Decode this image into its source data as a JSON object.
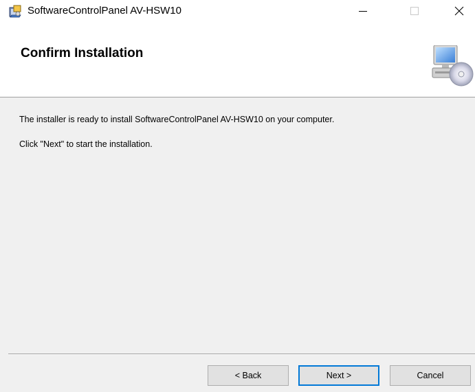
{
  "window": {
    "title": "SoftwareControlPanel AV-HSW10",
    "icons": {
      "app": "installer-app-icon",
      "minimize": "minimize-icon",
      "maximize": "maximize-icon",
      "close": "close-icon"
    }
  },
  "banner": {
    "title": "Confirm Installation",
    "icon": "computer-cd-icon"
  },
  "content": {
    "message_ready": "The installer is ready to install SoftwareControlPanel AV-HSW10 on your computer.",
    "message_next": "Click \"Next\" to start the installation."
  },
  "buttons": {
    "back": "< Back",
    "next": "Next >",
    "cancel": "Cancel"
  },
  "colors": {
    "accent": "#0078d7",
    "background": "#f0f0f0",
    "banner": "#ffffff"
  }
}
